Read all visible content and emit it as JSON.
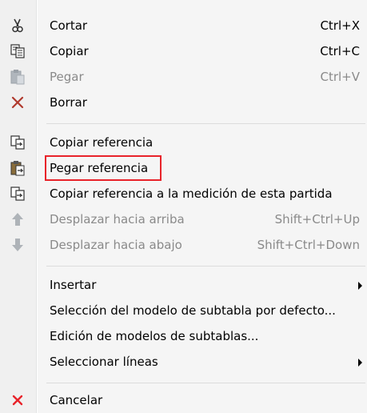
{
  "menu": {
    "items": [
      {
        "label": "Cortar",
        "shortcut": "Ctrl+X",
        "icon": "scissors-icon"
      },
      {
        "label": "Copiar",
        "shortcut": "Ctrl+C",
        "icon": "copy-icon"
      },
      {
        "label": "Pegar",
        "shortcut": "Ctrl+V",
        "icon": "paste-icon",
        "disabled": true
      },
      {
        "label": "Borrar",
        "icon": "delete-x-icon"
      },
      {
        "label": "Copiar referencia",
        "icon": "copy-reference-icon"
      },
      {
        "label": "Pegar referencia",
        "icon": "paste-reference-icon",
        "highlighted": true
      },
      {
        "label": "Copiar referencia a la medición de esta partida",
        "icon": "copy-reference-measure-icon"
      },
      {
        "label": "Desplazar hacia arriba",
        "shortcut": "Shift+Ctrl+Up",
        "icon": "arrow-up-icon",
        "disabled": true
      },
      {
        "label": "Desplazar hacia abajo",
        "shortcut": "Shift+Ctrl+Down",
        "icon": "arrow-down-icon",
        "disabled": true
      },
      {
        "label": "Insertar",
        "submenu": true
      },
      {
        "label": "Selección del modelo de subtabla por defecto..."
      },
      {
        "label": "Edición de modelos de subtablas..."
      },
      {
        "label": "Seleccionar líneas",
        "submenu": true
      },
      {
        "label": "Cancelar",
        "icon": "cancel-x-icon"
      }
    ]
  },
  "colors": {
    "highlight_border": "#e8232a",
    "disabled_text": "#8a8a8a",
    "delete_icon": "#c0392b",
    "cancel_icon": "#e8232a"
  }
}
